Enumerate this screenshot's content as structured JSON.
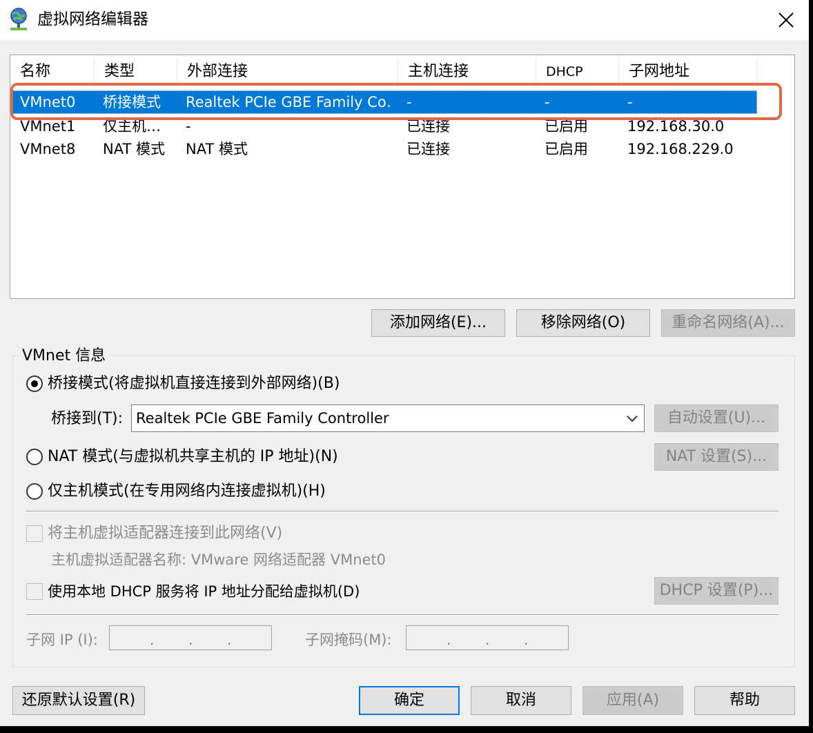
{
  "window": {
    "title": "虚拟网络编辑器",
    "icon": "network-globe-icon",
    "close_icon": "close-icon"
  },
  "list": {
    "columns": [
      "名称",
      "类型",
      "外部连接",
      "主机连接",
      "DHCP",
      "子网地址"
    ],
    "rows": [
      {
        "name": "VMnet0",
        "type": "桥接模式",
        "external": "Realtek PCIe GBE Family Co…",
        "host": "-",
        "dhcp": "-",
        "subnet": "-",
        "selected": true
      },
      {
        "name": "VMnet1",
        "type": "仅主机…",
        "external": "-",
        "host": "已连接",
        "dhcp": "已启用",
        "subnet": "192.168.30.0",
        "selected": false
      },
      {
        "name": "VMnet8",
        "type": "NAT 模式",
        "external": "NAT 模式",
        "host": "已连接",
        "dhcp": "已启用",
        "subnet": "192.168.229.0",
        "selected": false
      }
    ],
    "highlight_color": "#e06a45",
    "selection_color": "#0078d7"
  },
  "list_buttons": {
    "add": "添加网络(E)...",
    "remove": "移除网络(O)",
    "rename": "重命名网络(A)..."
  },
  "info": {
    "group_title": "VMnet 信息",
    "bridged_label": "桥接模式(将虚拟机直接连接到外部网络)(B)",
    "bridged_to_label": "桥接到(T):",
    "bridged_to_value": "Realtek PCIe GBE Family Controller",
    "auto_settings": "自动设置(U)...",
    "nat_label": "NAT 模式(与虚拟机共享主机的 IP 地址)(N)",
    "nat_settings": "NAT 设置(S)...",
    "hostonly_label": "仅主机模式(在专用网络内连接虚拟机)(H)",
    "connect_adapter_label": "将主机虚拟适配器连接到此网络(V)",
    "adapter_name_label": "主机虚拟适配器名称: VMware 网络适配器 VMnet0",
    "dhcp_label": "使用本地 DHCP 服务将 IP 地址分配给虚拟机(D)",
    "dhcp_settings": "DHCP 设置(P)...",
    "subnet_ip_label": "子网 IP (I):",
    "subnet_mask_label": "子网掩码(M):",
    "ip_dots": "."
  },
  "footer": {
    "restore": "还原默认设置(R)",
    "ok": "确定",
    "cancel": "取消",
    "apply": "应用(A)",
    "help": "帮助"
  }
}
